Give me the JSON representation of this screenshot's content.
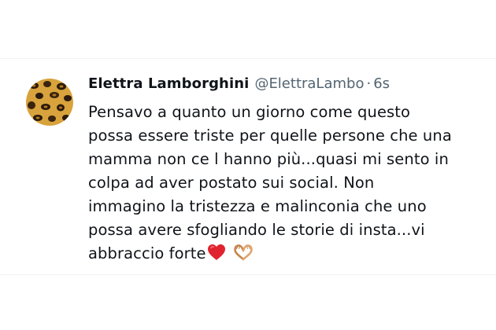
{
  "tweet": {
    "display_name": "Elettra Lamborghini",
    "handle": "@ElettraLambo",
    "separator": "·",
    "timestamp": "6s",
    "text_lines": [
      "Pensavo a quanto un giorno come questo",
      "possa essere triste per quelle persone che una",
      "mamma non ce l hanno più...quasi mi sento in",
      "colpa ad aver postato sui social. Non",
      "immagino la tristezza e malinconia che uno",
      "possa avere sfogliando le storie di insta...vi",
      "abbraccio forte"
    ],
    "emojis": [
      "red-heart-icon",
      "heart-hands-icon"
    ]
  },
  "colors": {
    "text_primary": "#0f1419",
    "text_secondary": "#536471",
    "border": "#eff3f4",
    "heart": "#e0242f",
    "hands": "#e0a56f"
  }
}
